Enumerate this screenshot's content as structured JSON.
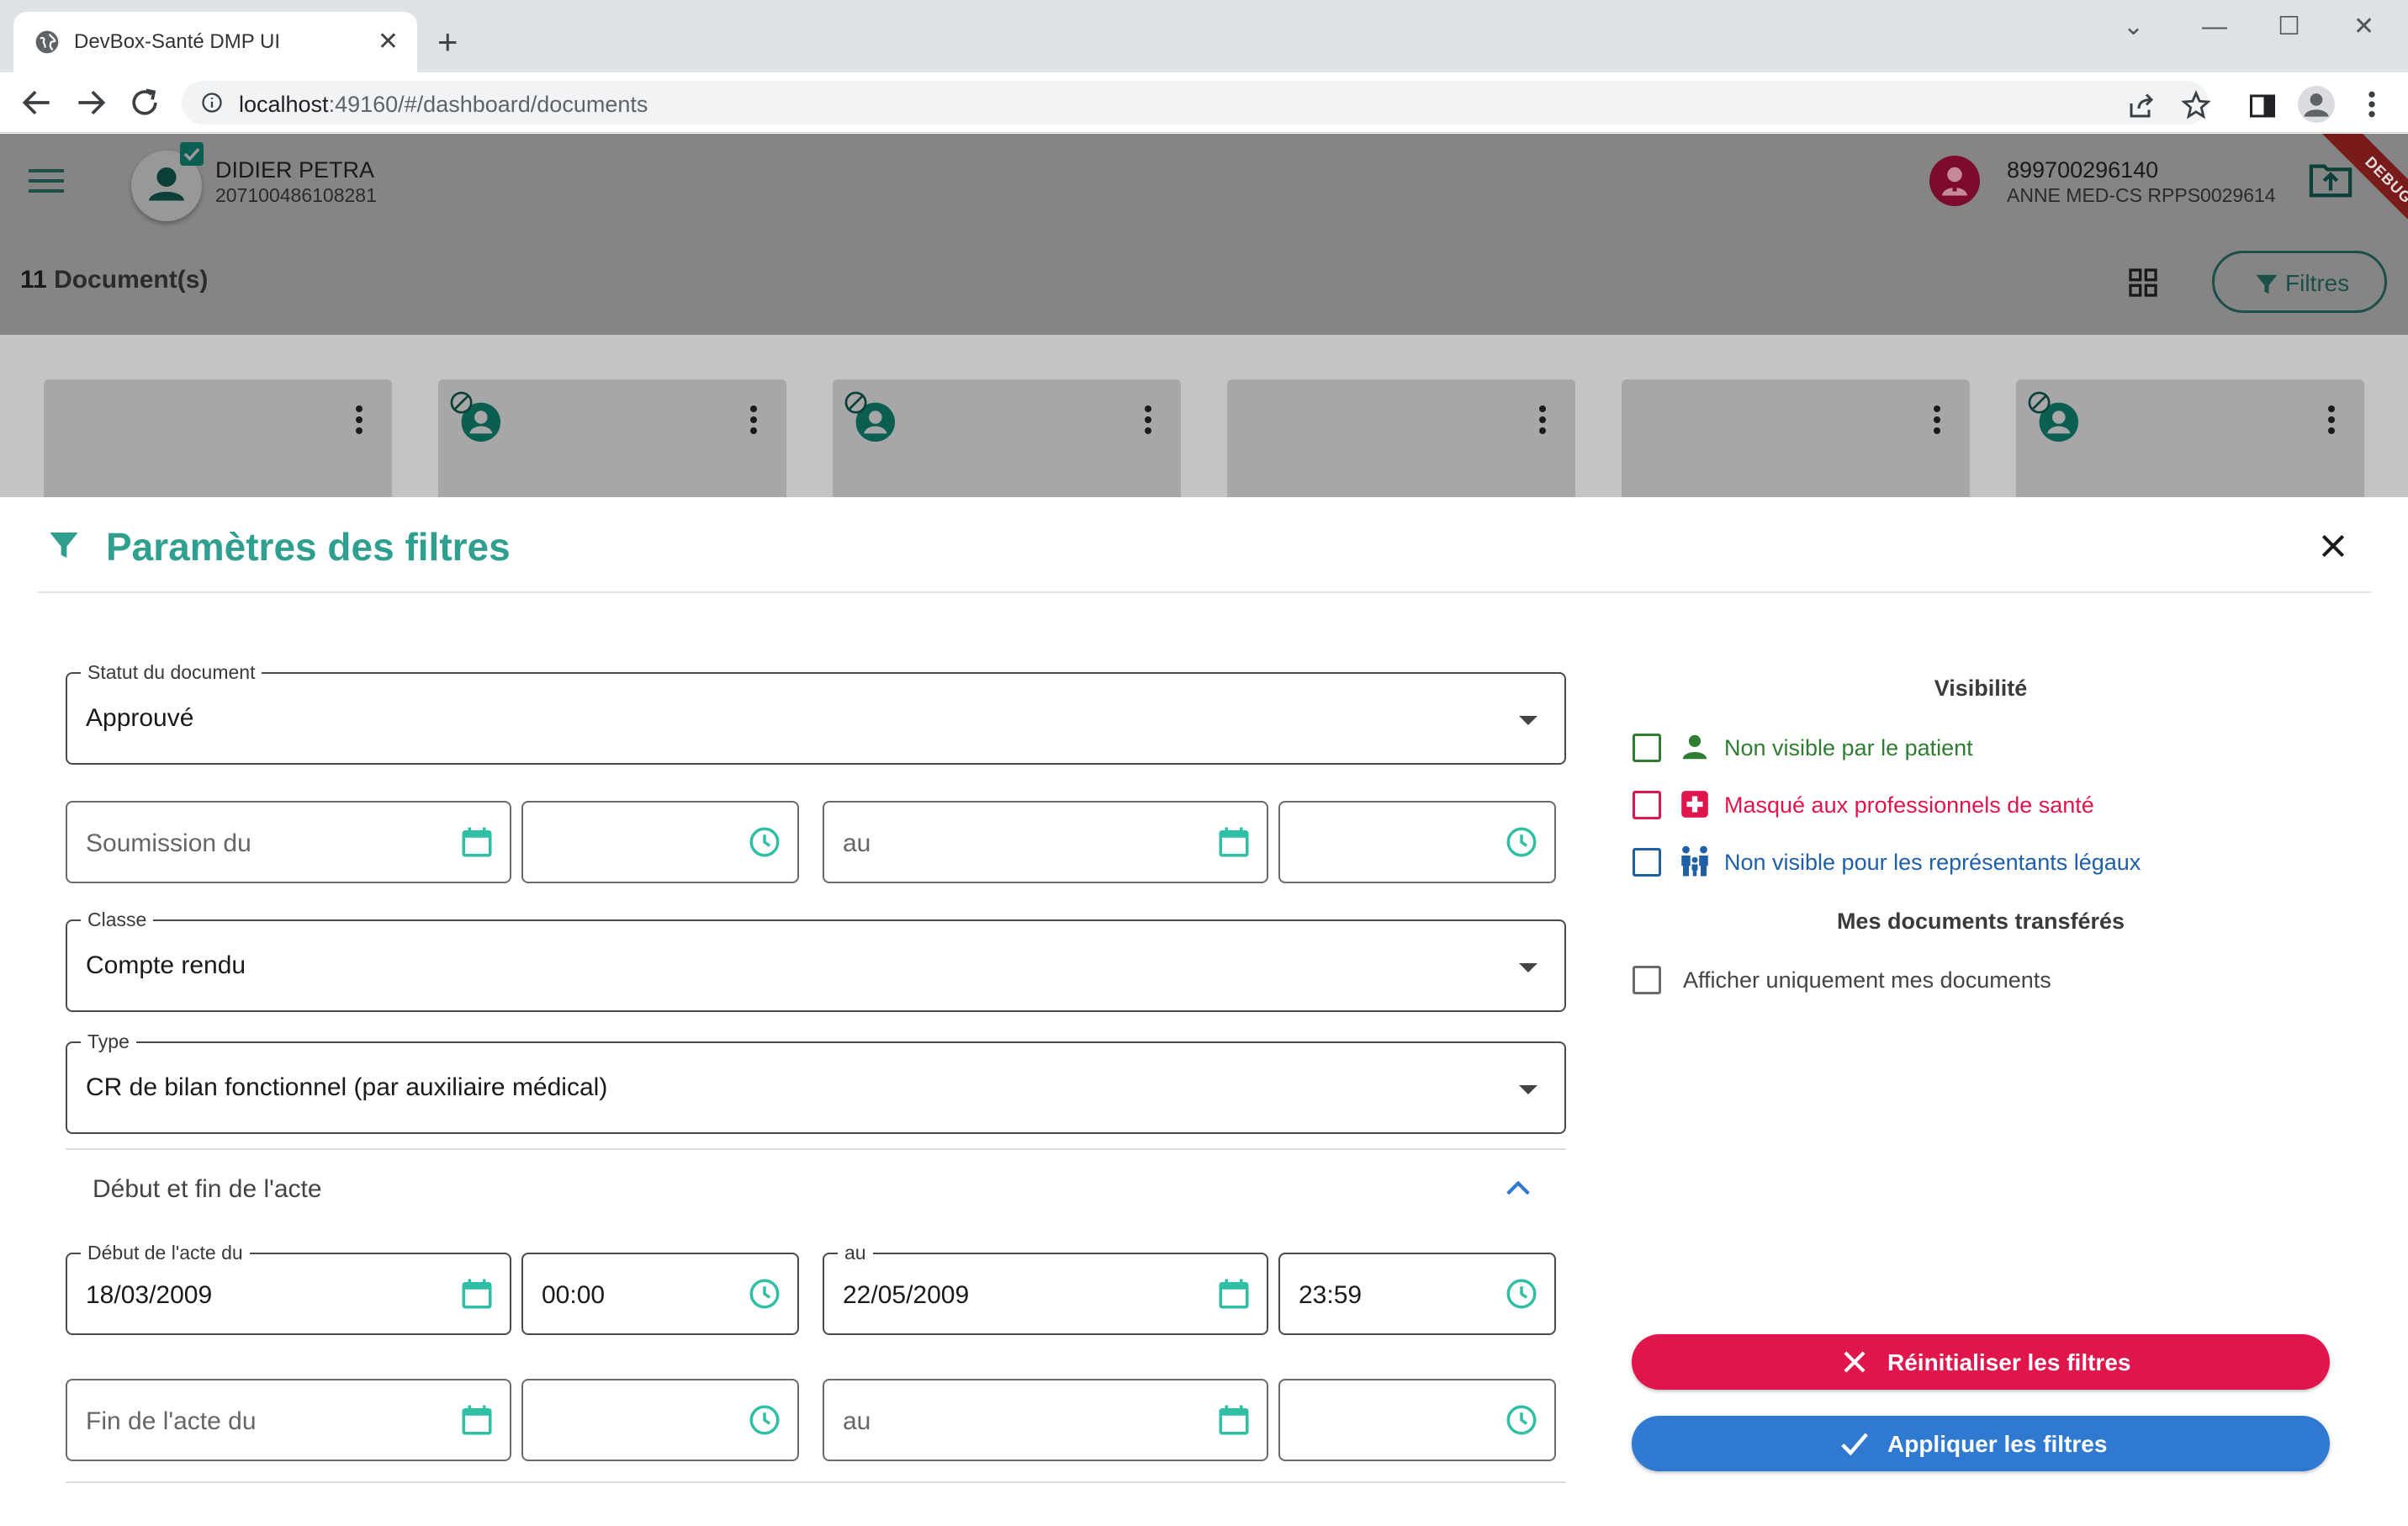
{
  "browser": {
    "tab_title": "DevBox-Santé DMP UI",
    "url_host": "localhost",
    "url_path": ":49160/#/dashboard/documents"
  },
  "header": {
    "patient_name": "DIDIER PETRA",
    "patient_ins": "207100486108281",
    "pro_id": "899700296140",
    "pro_name": "ANNE MED-CS RPPS0029614",
    "debug_label": "DEBUG"
  },
  "documents": {
    "count": "11",
    "count_label": "Document(s)",
    "filter_button": "Filtres",
    "cards": [
      {
        "hidden_from_patient": false
      },
      {
        "hidden_from_patient": true
      },
      {
        "hidden_from_patient": true
      },
      {
        "hidden_from_patient": false
      },
      {
        "hidden_from_patient": false
      },
      {
        "hidden_from_patient": true
      }
    ]
  },
  "filters": {
    "title": "Paramètres des filtres",
    "status": {
      "label": "Statut du document",
      "value": "Approuvé"
    },
    "submission": {
      "from_placeholder": "Soumission du",
      "to_placeholder": "au"
    },
    "class": {
      "label": "Classe",
      "value": "Compte rendu"
    },
    "type": {
      "label": "Type",
      "value": "CR de bilan fonctionnel (par auxiliaire médical)"
    },
    "act_section": {
      "title": "Début et fin de l'acte",
      "start_from_label": "Début de l'acte du",
      "start_from_date": "18/03/2009",
      "start_from_time": "00:00",
      "start_to_label": "au",
      "start_to_date": "22/05/2009",
      "start_to_time": "23:59",
      "end_from_placeholder": "Fin de l'acte du",
      "end_to_placeholder": "au"
    },
    "visibility": {
      "title": "Visibilité",
      "options": [
        {
          "label": "Non visible par le patient",
          "color": "#2e7d32",
          "checked": false
        },
        {
          "label": "Masqué aux professionnels de santé",
          "color": "#e0154b",
          "checked": false
        },
        {
          "label": "Non visible pour les représentants légaux",
          "color": "#1e5fa8",
          "checked": false
        }
      ]
    },
    "transferred": {
      "title": "Mes documents transférés",
      "option_label": "Afficher uniquement mes documents",
      "checked": false
    },
    "reset_button": "Réinitialiser les filtres",
    "apply_button": "Appliquer les filtres"
  },
  "colors": {
    "accent": "#2f9f8f",
    "reset": "#e0154b",
    "apply": "#2f7ad0"
  }
}
